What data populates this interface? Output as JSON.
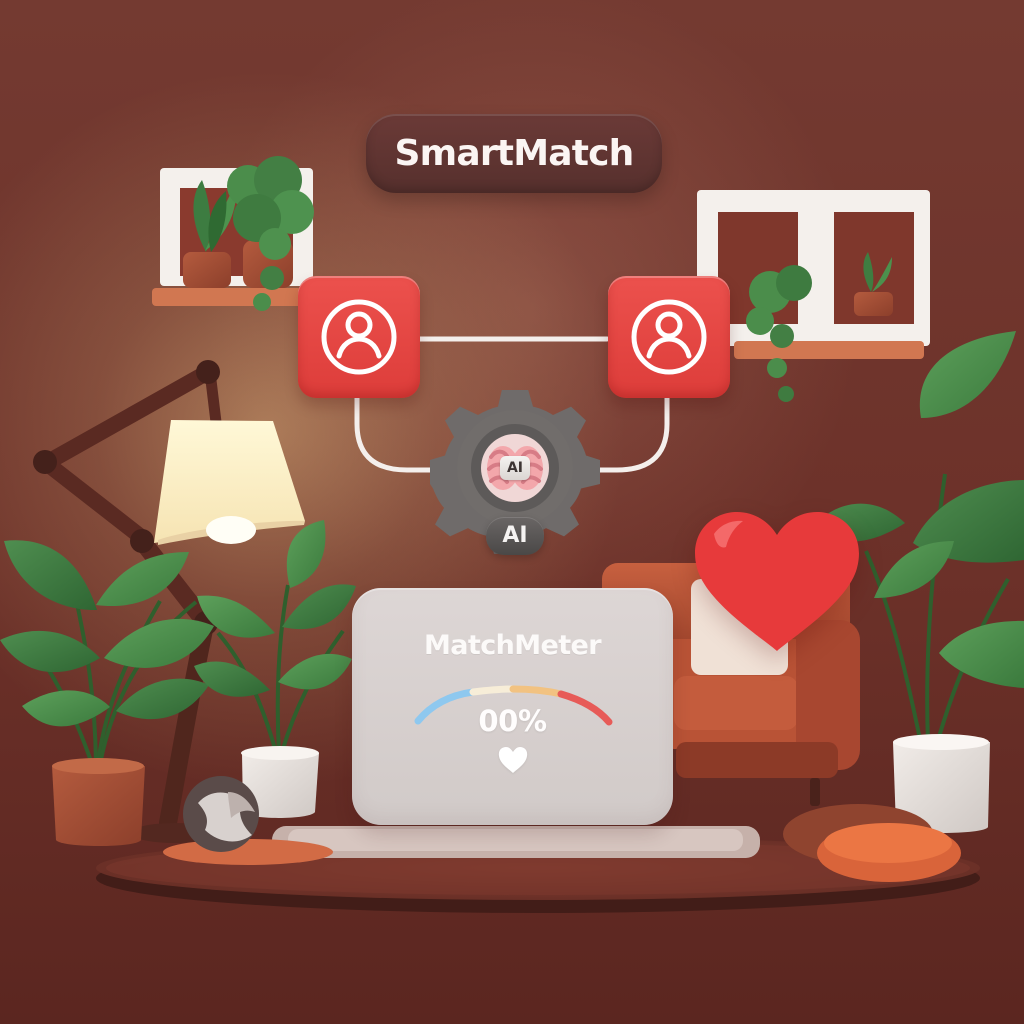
{
  "header": {
    "app_name": "SmartMatch"
  },
  "matching_flow": {
    "left_icon": "user-icon",
    "right_icon": "user-icon",
    "engine_icon": "gear-icon",
    "brain_icon": "brain-icon",
    "brain_label": "AI",
    "engine_badge": "AI"
  },
  "meter": {
    "title": "MatchMeter",
    "value_text": "00%",
    "heart_icon": "heart-icon",
    "gauge_colors": [
      "#8ec8ef",
      "#f7edd8",
      "#f2c281",
      "#e75b58"
    ]
  },
  "decor": {
    "large_heart_icon": "heart-icon"
  },
  "colors": {
    "background": "#6c3129",
    "title_pill": "#5f3431",
    "accent_red": "#e54a47",
    "meter_card": "#d8d1cf",
    "connector": "#f4efec",
    "heart_red": "#e73a3b"
  }
}
